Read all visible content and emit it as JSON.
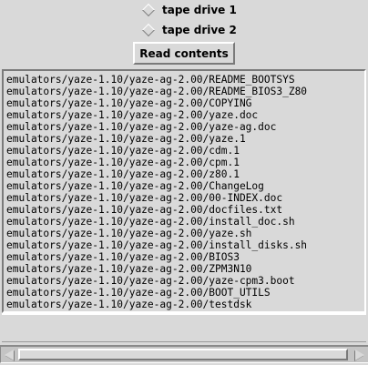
{
  "radios": [
    {
      "label": "tape drive 1",
      "selected": false
    },
    {
      "label": "tape drive 2",
      "selected": false
    }
  ],
  "read_button": {
    "label": "Read contents"
  },
  "files": [
    "emulators/yaze-1.10/yaze-ag-2.00/README_BOOTSYS",
    "emulators/yaze-1.10/yaze-ag-2.00/README_BIOS3_Z80",
    "emulators/yaze-1.10/yaze-ag-2.00/COPYING",
    "emulators/yaze-1.10/yaze-ag-2.00/yaze.doc",
    "emulators/yaze-1.10/yaze-ag-2.00/yaze-ag.doc",
    "emulators/yaze-1.10/yaze-ag-2.00/yaze.1",
    "emulators/yaze-1.10/yaze-ag-2.00/cdm.1",
    "emulators/yaze-1.10/yaze-ag-2.00/cpm.1",
    "emulators/yaze-1.10/yaze-ag-2.00/z80.1",
    "emulators/yaze-1.10/yaze-ag-2.00/ChangeLog",
    "emulators/yaze-1.10/yaze-ag-2.00/00-INDEX.doc",
    "emulators/yaze-1.10/yaze-ag-2.00/docfiles.txt",
    "emulators/yaze-1.10/yaze-ag-2.00/install_doc.sh",
    "emulators/yaze-1.10/yaze-ag-2.00/yaze.sh",
    "emulators/yaze-1.10/yaze-ag-2.00/install_disks.sh",
    "emulators/yaze-1.10/yaze-ag-2.00/BIOS3",
    "emulators/yaze-1.10/yaze-ag-2.00/ZPM3N10",
    "emulators/yaze-1.10/yaze-ag-2.00/yaze-cpm3.boot",
    "emulators/yaze-1.10/yaze-ag-2.00/BOOT_UTILS",
    "emulators/yaze-1.10/yaze-ag-2.00/testdsk"
  ],
  "scrollbar": {
    "left_icon": "arrow-left-icon",
    "right_icon": "arrow-right-icon"
  }
}
